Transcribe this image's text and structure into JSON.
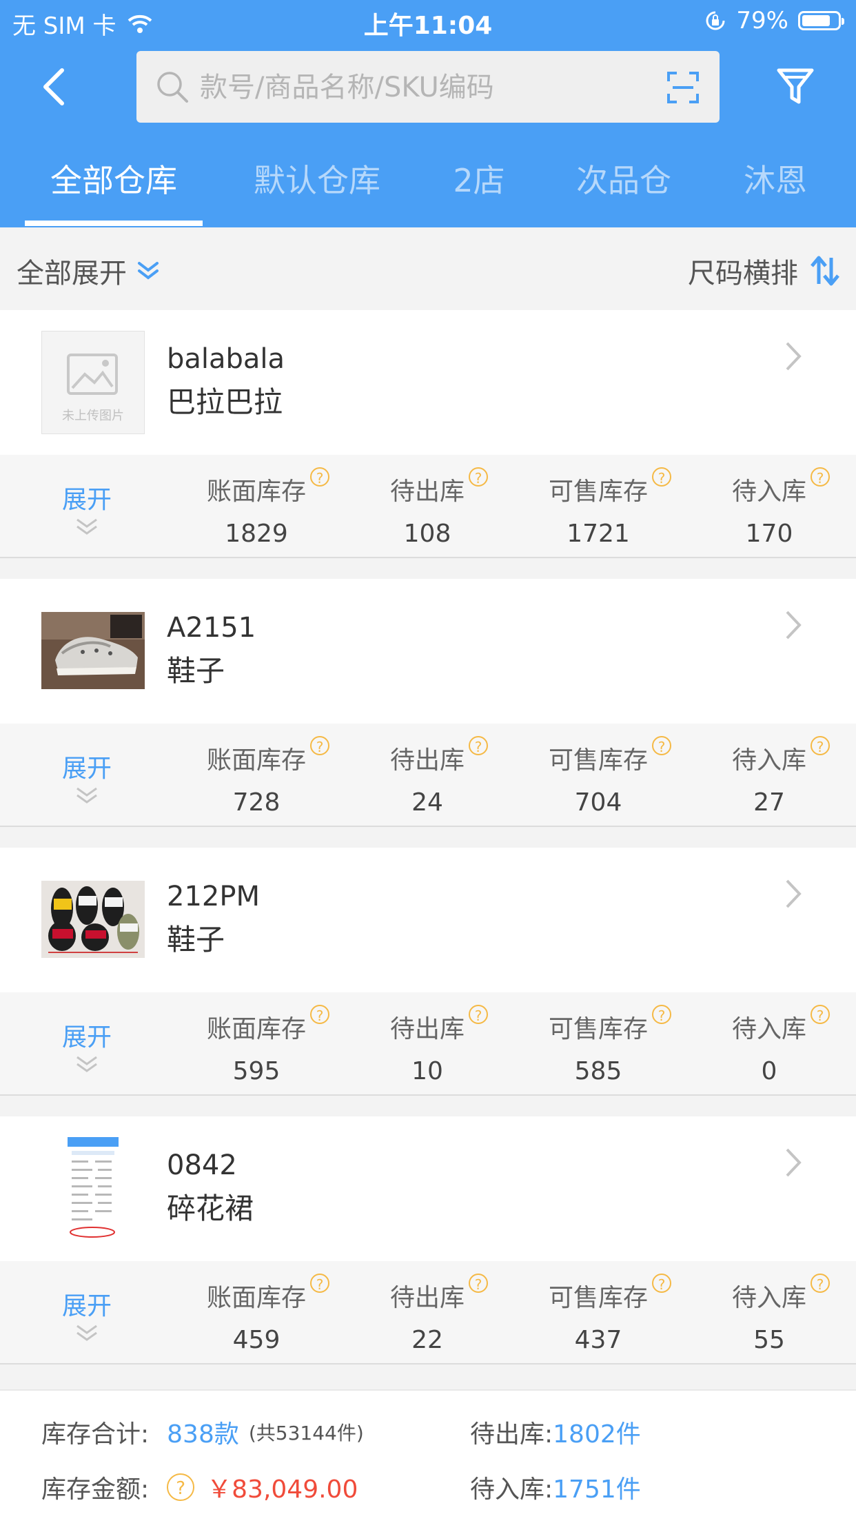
{
  "status_bar": {
    "carrier": "无 SIM 卡",
    "time": "上午11:04",
    "battery": "79%",
    "battery_level": 0.79
  },
  "search": {
    "placeholder": "款号/商品名称/SKU编码",
    "value": ""
  },
  "tabs": [
    {
      "label": "全部仓库",
      "active": true
    },
    {
      "label": "默认仓库",
      "active": false
    },
    {
      "label": "2店",
      "active": false
    },
    {
      "label": "次品仓",
      "active": false
    },
    {
      "label": "沐恩",
      "active": false
    }
  ],
  "toolbar": {
    "expand_all_label": "全部展开",
    "size_layout_label": "尺码横排"
  },
  "stat_labels": {
    "book_stock": "账面库存",
    "pending_out": "待出库",
    "sellable_stock": "可售库存",
    "pending_in": "待入库"
  },
  "expand_label": "展开",
  "placeholder_image_text": "未上传图片",
  "products": [
    {
      "code": "balabala",
      "name": "巴拉巴拉",
      "image": "no-image-placeholder",
      "book_stock": "1829",
      "pending_out": "108",
      "sellable_stock": "1721",
      "pending_in": "170"
    },
    {
      "code": "A2151",
      "name": "鞋子",
      "image": "sneaker-photo",
      "book_stock": "728",
      "pending_out": "24",
      "sellable_stock": "704",
      "pending_in": "27"
    },
    {
      "code": "212PM",
      "name": "鞋子",
      "image": "slides-photo",
      "book_stock": "595",
      "pending_out": "10",
      "sellable_stock": "585",
      "pending_in": "0"
    },
    {
      "code": "0842",
      "name": "碎花裙",
      "image": "screenshot-photo",
      "book_stock": "459",
      "pending_out": "22",
      "sellable_stock": "437",
      "pending_in": "55"
    }
  ],
  "summary": {
    "stock_total_label": "库存合计:",
    "stock_total_value": "838款",
    "stock_total_pieces": "(共53144件)",
    "stock_amount_label": "库存金额:",
    "stock_amount_value": "￥83,049.00",
    "pending_out_label": "待出库:",
    "pending_out_value": "1802件",
    "pending_in_label": "待入库:",
    "pending_in_value": "1751件"
  },
  "colors": {
    "header_blue": "#4a9ff5",
    "help_orange": "#f5b945",
    "amount_red": "#f04b3a"
  }
}
